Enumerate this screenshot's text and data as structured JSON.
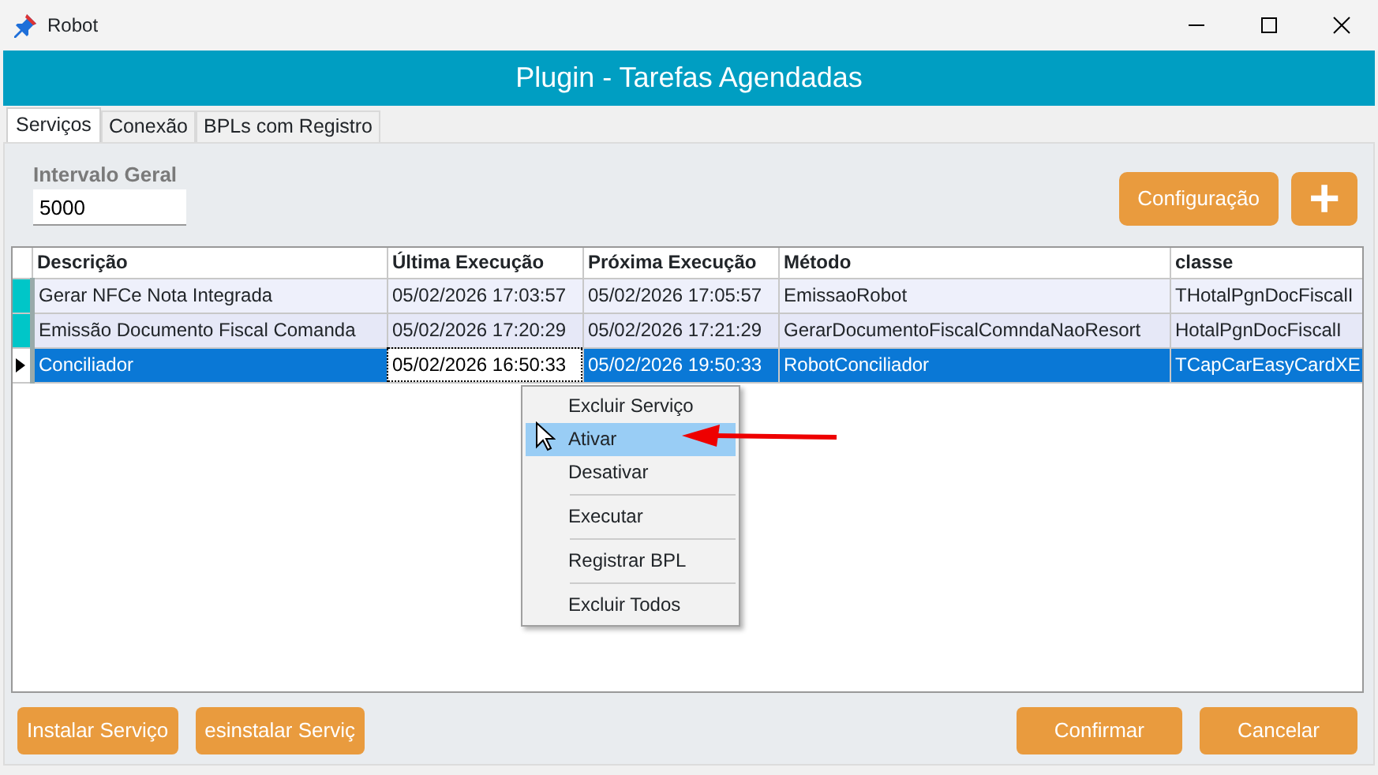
{
  "window": {
    "title": "Robot"
  },
  "header": {
    "title": "Plugin - Tarefas Agendadas"
  },
  "tabs": [
    {
      "label": "Serviços",
      "selected": true
    },
    {
      "label": "Conexão",
      "selected": false
    },
    {
      "label": "BPLs com Registro",
      "selected": false
    }
  ],
  "interval": {
    "label": "Intervalo Geral",
    "value": "5000"
  },
  "top_buttons": [
    {
      "kind": "text",
      "label": "Configuração"
    },
    {
      "kind": "plus",
      "label": "+"
    }
  ],
  "table": {
    "columns": [
      "Descrição",
      "Última Execução",
      "Próxima Execução",
      "Método",
      "classe"
    ],
    "rows": [
      {
        "selected": false,
        "cells": [
          "Gerar NFCe Nota Integrada",
          "05/02/2026 17:03:57",
          "05/02/2026 17:05:57",
          "EmissaoRobot",
          "THotalPgnDocFiscalI"
        ]
      },
      {
        "selected": false,
        "cells": [
          "Emissão Documento Fiscal Comanda",
          "05/02/2026 17:20:29",
          "05/02/2026 17:21:29",
          "GerarDocumentoFiscalComndaNaoResort",
          "HotalPgnDocFiscalI"
        ]
      },
      {
        "selected": true,
        "cells": [
          "Conciliador",
          "05/02/2026 16:50:33",
          "05/02/2026 19:50:33",
          "RobotConciliador",
          "TCapCarEasyCardXE"
        ]
      }
    ]
  },
  "context_menu": {
    "items": [
      {
        "label": "Excluir Serviço",
        "selected": false,
        "divider_after": false
      },
      {
        "label": "Ativar",
        "selected": true,
        "divider_after": false
      },
      {
        "label": "Desativar",
        "selected": false,
        "divider_after": true
      },
      {
        "label": "Executar",
        "selected": false,
        "divider_after": true
      },
      {
        "label": "Registrar BPL",
        "selected": false,
        "divider_after": true
      },
      {
        "label": "Excluir Todos",
        "selected": false,
        "divider_after": false
      }
    ]
  },
  "bottom_left_buttons": [
    "Instalar Serviço",
    "esinstalar Serviç"
  ],
  "bottom_right_buttons": [
    "Confirmar",
    "Cancelar"
  ]
}
